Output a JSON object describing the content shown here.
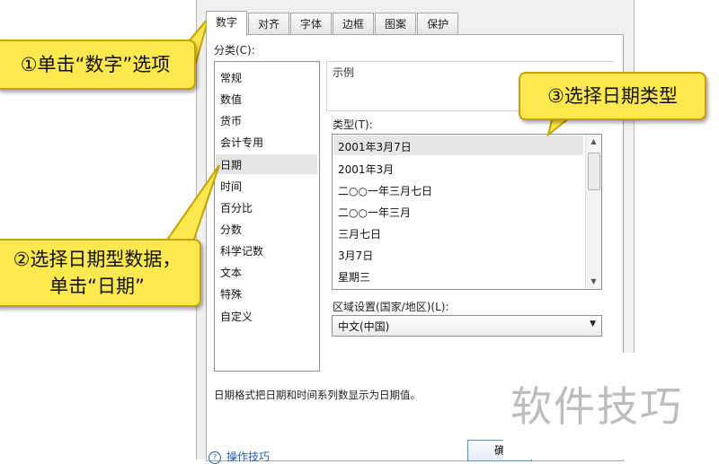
{
  "tabs": [
    "数字",
    "对齐",
    "字体",
    "边框",
    "图案",
    "保护"
  ],
  "category": {
    "label": "分类(C):",
    "items": [
      "常规",
      "数值",
      "货币",
      "会计专用",
      "日期",
      "时间",
      "百分比",
      "分数",
      "科学记数",
      "文本",
      "特殊",
      "自定义"
    ],
    "selected": "日期"
  },
  "sample": {
    "label": "示例"
  },
  "type": {
    "label": "类型(T):",
    "items": [
      "2001年3月7日",
      "2001年3月",
      "二○○一年三月七日",
      "二○○一年三月",
      "三月七日",
      "3月7日",
      "星期三"
    ],
    "selected": "2001年3月7日"
  },
  "locale": {
    "label": "区域设置(国家/地区)(L):",
    "value": "中文(中国)"
  },
  "description": "日期格式把日期和时间系列数显示为日期值。",
  "footer": {
    "tips": "操作技巧",
    "ok_label": "确"
  },
  "callouts": {
    "c1": "①单击“数字”选项",
    "c2_line1": "②选择日期型数据，",
    "c2_line2": "单击“日期”",
    "c3": "③选择日期类型"
  },
  "watermark": "软件技巧",
  "colors": {
    "callout_fill": "#fde84f",
    "callout_border": "#c7a100",
    "selection": "#e5e5e5",
    "link": "#1d5db5"
  }
}
